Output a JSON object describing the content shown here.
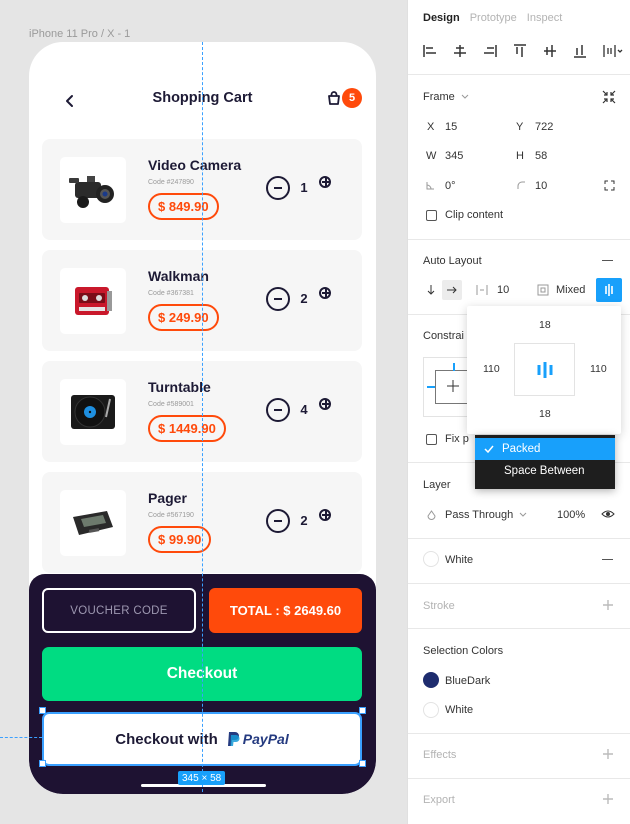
{
  "canvas": {
    "frame_label": "iPhone 11 Pro / X - 1",
    "size_chip": "345 × 58"
  },
  "app": {
    "header": {
      "title": "Shopping Cart",
      "cart_count": "5"
    },
    "items": [
      {
        "name": "Video Camera",
        "code": "Code #247890",
        "price": "$ 849.90",
        "qty": "1",
        "icon": "video-camera-icon"
      },
      {
        "name": "Walkman",
        "code": "Code #367381",
        "price": "$ 249.90",
        "qty": "2",
        "icon": "walkman-icon"
      },
      {
        "name": "Turntable",
        "code": "Code #589001",
        "price": "$ 1449.90",
        "qty": "4",
        "icon": "turntable-icon"
      },
      {
        "name": "Pager",
        "code": "Code #567190",
        "price": "$ 99.90",
        "qty": "2",
        "icon": "pager-icon"
      }
    ],
    "bottom": {
      "voucher": "VOUCHER CODE",
      "total": "TOTAL : $ 2649.60",
      "checkout": "Checkout",
      "paypal_prefix": "Checkout with",
      "paypal_brand": "PayPal"
    }
  },
  "panel": {
    "tabs": [
      "Design",
      "Prototype",
      "Inspect"
    ],
    "frame": {
      "title": "Frame",
      "x_label": "X",
      "x": "15",
      "y_label": "Y",
      "y": "722",
      "w_label": "W",
      "w": "345",
      "h_label": "H",
      "h": "58",
      "rotation": "0°",
      "radius": "10",
      "clip_content": "Clip content"
    },
    "auto_layout": {
      "title": "Auto Layout",
      "spacing": "10",
      "padding": "Mixed"
    },
    "popover": {
      "top": "18",
      "left": "110",
      "right": "110",
      "bottom": "18"
    },
    "dropdown": {
      "selected": "Packed",
      "other": "Space Between"
    },
    "constraints": {
      "title": "Constrai",
      "fix_label": "Fix p"
    },
    "layer": {
      "title": "Layer",
      "blend": "Pass Through",
      "opacity": "100%"
    },
    "fill": {
      "name": "White"
    },
    "stroke": {
      "title": "Stroke"
    },
    "selection_colors": {
      "title": "Selection Colors",
      "items": [
        {
          "name": "BlueDark",
          "color": "#1e2c6e"
        },
        {
          "name": "White",
          "color": "#ffffff"
        }
      ]
    },
    "effects": {
      "title": "Effects"
    },
    "export": {
      "title": "Export"
    }
  },
  "colors": {
    "accent": "#ff4a0b",
    "dark": "#1e1232",
    "green": "#00dc82",
    "selection": "#18a0fb"
  }
}
